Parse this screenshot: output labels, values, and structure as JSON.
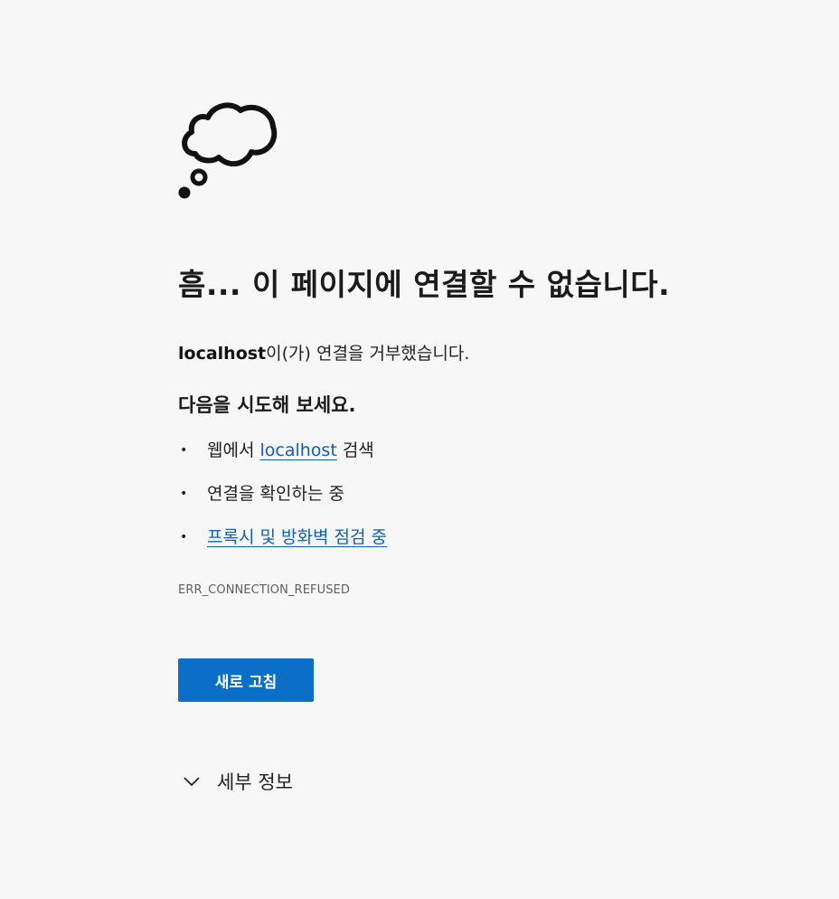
{
  "error_page": {
    "icon": "thought-cloud-icon",
    "title": "흠... 이 페이지에 연결할 수 없습니다.",
    "description": {
      "host": "localhost",
      "message": "이(가) 연결을 거부했습니다."
    },
    "try_heading": "다음을 시도해 보세요.",
    "suggestions": [
      {
        "prefix": "웹에서 ",
        "link": "localhost",
        "suffix": " 검색"
      },
      {
        "text": "연결을 확인하는 중"
      },
      {
        "link": "프록시 및 방화벽 점검 중"
      }
    ],
    "bullet": "•",
    "error_code": "ERR_CONNECTION_REFUSED",
    "reload_button": "새로 고침",
    "details_toggle": {
      "icon": "chevron-down-icon",
      "label": "세부 정보"
    }
  },
  "colors": {
    "background": "#f7f7f7",
    "link": "#0e61b5",
    "button": "#0b6fc8",
    "button_text": "#ffffff"
  }
}
